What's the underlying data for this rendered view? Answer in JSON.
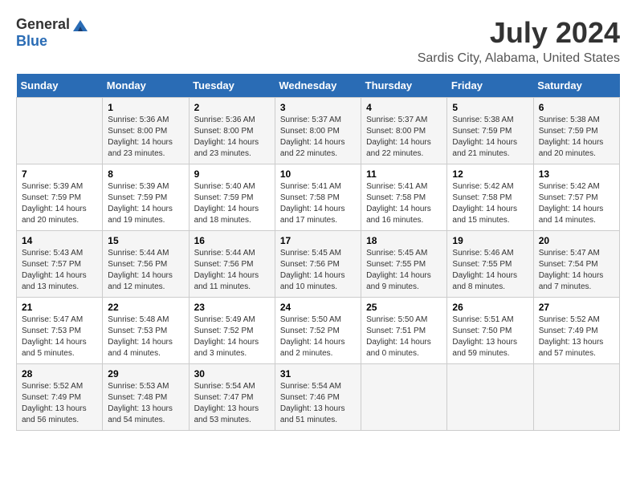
{
  "header": {
    "logo_general": "General",
    "logo_blue": "Blue",
    "month_year": "July 2024",
    "location": "Sardis City, Alabama, United States"
  },
  "calendar": {
    "days_of_week": [
      "Sunday",
      "Monday",
      "Tuesday",
      "Wednesday",
      "Thursday",
      "Friday",
      "Saturday"
    ],
    "weeks": [
      [
        {
          "day": "",
          "info": ""
        },
        {
          "day": "1",
          "info": "Sunrise: 5:36 AM\nSunset: 8:00 PM\nDaylight: 14 hours\nand 23 minutes."
        },
        {
          "day": "2",
          "info": "Sunrise: 5:36 AM\nSunset: 8:00 PM\nDaylight: 14 hours\nand 23 minutes."
        },
        {
          "day": "3",
          "info": "Sunrise: 5:37 AM\nSunset: 8:00 PM\nDaylight: 14 hours\nand 22 minutes."
        },
        {
          "day": "4",
          "info": "Sunrise: 5:37 AM\nSunset: 8:00 PM\nDaylight: 14 hours\nand 22 minutes."
        },
        {
          "day": "5",
          "info": "Sunrise: 5:38 AM\nSunset: 7:59 PM\nDaylight: 14 hours\nand 21 minutes."
        },
        {
          "day": "6",
          "info": "Sunrise: 5:38 AM\nSunset: 7:59 PM\nDaylight: 14 hours\nand 20 minutes."
        }
      ],
      [
        {
          "day": "7",
          "info": "Sunrise: 5:39 AM\nSunset: 7:59 PM\nDaylight: 14 hours\nand 20 minutes."
        },
        {
          "day": "8",
          "info": "Sunrise: 5:39 AM\nSunset: 7:59 PM\nDaylight: 14 hours\nand 19 minutes."
        },
        {
          "day": "9",
          "info": "Sunrise: 5:40 AM\nSunset: 7:59 PM\nDaylight: 14 hours\nand 18 minutes."
        },
        {
          "day": "10",
          "info": "Sunrise: 5:41 AM\nSunset: 7:58 PM\nDaylight: 14 hours\nand 17 minutes."
        },
        {
          "day": "11",
          "info": "Sunrise: 5:41 AM\nSunset: 7:58 PM\nDaylight: 14 hours\nand 16 minutes."
        },
        {
          "day": "12",
          "info": "Sunrise: 5:42 AM\nSunset: 7:58 PM\nDaylight: 14 hours\nand 15 minutes."
        },
        {
          "day": "13",
          "info": "Sunrise: 5:42 AM\nSunset: 7:57 PM\nDaylight: 14 hours\nand 14 minutes."
        }
      ],
      [
        {
          "day": "14",
          "info": "Sunrise: 5:43 AM\nSunset: 7:57 PM\nDaylight: 14 hours\nand 13 minutes."
        },
        {
          "day": "15",
          "info": "Sunrise: 5:44 AM\nSunset: 7:56 PM\nDaylight: 14 hours\nand 12 minutes."
        },
        {
          "day": "16",
          "info": "Sunrise: 5:44 AM\nSunset: 7:56 PM\nDaylight: 14 hours\nand 11 minutes."
        },
        {
          "day": "17",
          "info": "Sunrise: 5:45 AM\nSunset: 7:56 PM\nDaylight: 14 hours\nand 10 minutes."
        },
        {
          "day": "18",
          "info": "Sunrise: 5:45 AM\nSunset: 7:55 PM\nDaylight: 14 hours\nand 9 minutes."
        },
        {
          "day": "19",
          "info": "Sunrise: 5:46 AM\nSunset: 7:55 PM\nDaylight: 14 hours\nand 8 minutes."
        },
        {
          "day": "20",
          "info": "Sunrise: 5:47 AM\nSunset: 7:54 PM\nDaylight: 14 hours\nand 7 minutes."
        }
      ],
      [
        {
          "day": "21",
          "info": "Sunrise: 5:47 AM\nSunset: 7:53 PM\nDaylight: 14 hours\nand 5 minutes."
        },
        {
          "day": "22",
          "info": "Sunrise: 5:48 AM\nSunset: 7:53 PM\nDaylight: 14 hours\nand 4 minutes."
        },
        {
          "day": "23",
          "info": "Sunrise: 5:49 AM\nSunset: 7:52 PM\nDaylight: 14 hours\nand 3 minutes."
        },
        {
          "day": "24",
          "info": "Sunrise: 5:50 AM\nSunset: 7:52 PM\nDaylight: 14 hours\nand 2 minutes."
        },
        {
          "day": "25",
          "info": "Sunrise: 5:50 AM\nSunset: 7:51 PM\nDaylight: 14 hours\nand 0 minutes."
        },
        {
          "day": "26",
          "info": "Sunrise: 5:51 AM\nSunset: 7:50 PM\nDaylight: 13 hours\nand 59 minutes."
        },
        {
          "day": "27",
          "info": "Sunrise: 5:52 AM\nSunset: 7:49 PM\nDaylight: 13 hours\nand 57 minutes."
        }
      ],
      [
        {
          "day": "28",
          "info": "Sunrise: 5:52 AM\nSunset: 7:49 PM\nDaylight: 13 hours\nand 56 minutes."
        },
        {
          "day": "29",
          "info": "Sunrise: 5:53 AM\nSunset: 7:48 PM\nDaylight: 13 hours\nand 54 minutes."
        },
        {
          "day": "30",
          "info": "Sunrise: 5:54 AM\nSunset: 7:47 PM\nDaylight: 13 hours\nand 53 minutes."
        },
        {
          "day": "31",
          "info": "Sunrise: 5:54 AM\nSunset: 7:46 PM\nDaylight: 13 hours\nand 51 minutes."
        },
        {
          "day": "",
          "info": ""
        },
        {
          "day": "",
          "info": ""
        },
        {
          "day": "",
          "info": ""
        }
      ]
    ]
  }
}
